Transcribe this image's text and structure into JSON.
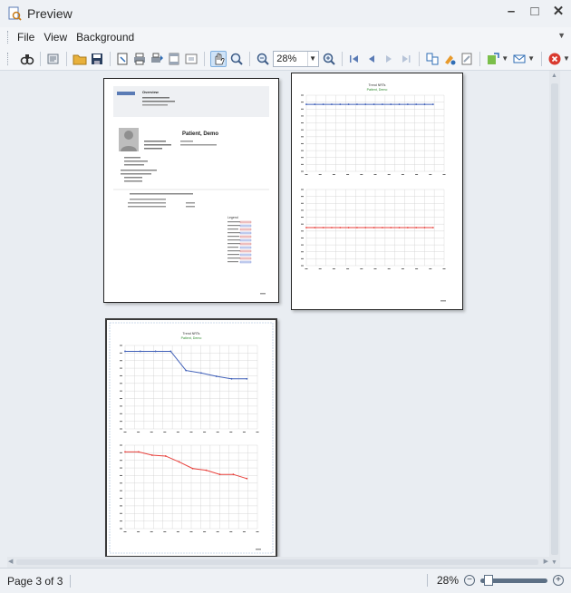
{
  "window": {
    "title": "Preview"
  },
  "menu": {
    "items": [
      "File",
      "View",
      "Background"
    ]
  },
  "toolbar": {
    "zoom_value": "28%",
    "buttons": [
      "find-icon",
      "open-icon",
      "save-icon",
      "page-setup-icon",
      "print-icon",
      "quick-print-icon",
      "header-footer-icon",
      "scale-icon",
      "hand-tool-icon",
      "magnifier-icon",
      "zoom-out-icon",
      "zoom-in-icon",
      "first-page-icon",
      "previous-page-icon",
      "next-page-icon",
      "last-page-icon",
      "multiple-pages-icon",
      "color-icon",
      "watermark-icon",
      "export-icon",
      "send-icon",
      "close-preview-icon"
    ]
  },
  "report": {
    "page1": {
      "header_title": "Overview",
      "patient_name": "Patient, Demo",
      "legend_title": "Legend"
    },
    "chart_pages": {
      "title": "Trend NRTs",
      "subtitle": "Patient, Demo"
    }
  },
  "status": {
    "page_text": "Page 3 of 3",
    "zoom_text": "28%"
  },
  "chart_data": [
    {
      "type": "line",
      "title": "Trend NRTs",
      "subtitle": "Patient, Demo",
      "x": [
        1,
        2,
        3,
        4,
        5,
        6,
        7,
        8,
        9,
        10,
        11,
        12,
        13,
        14,
        15,
        16
      ],
      "series": [
        {
          "values": [
            88,
            88,
            88,
            88,
            88,
            88,
            88,
            88,
            88,
            88,
            88,
            88,
            88,
            88,
            88,
            88
          ],
          "color": "#3f5fb8"
        }
      ],
      "ylim": [
        0,
        100
      ],
      "grid": true
    },
    {
      "type": "line",
      "x": [
        1,
        2,
        3,
        4,
        5,
        6,
        7,
        8,
        9,
        10,
        11,
        12,
        13,
        14,
        15,
        16
      ],
      "series": [
        {
          "values": [
            50,
            50,
            50,
            50,
            50,
            50,
            50,
            50,
            50,
            50,
            50,
            50,
            50,
            50,
            50,
            50
          ],
          "color": "#e8413c"
        }
      ],
      "ylim": [
        0,
        100
      ],
      "grid": true
    },
    {
      "type": "line",
      "title": "Trend NRTs",
      "subtitle": "Patient, Demo",
      "x": [
        1,
        2,
        3,
        4,
        5,
        6,
        7,
        8,
        9
      ],
      "series": [
        {
          "values": [
            93,
            93,
            93,
            93,
            70,
            67,
            63,
            60,
            60
          ],
          "color": "#3f5fb8"
        }
      ],
      "ylim": [
        0,
        100
      ],
      "grid": true
    },
    {
      "type": "line",
      "x": [
        1,
        2,
        3,
        4,
        5,
        6,
        7,
        8,
        9,
        10
      ],
      "series": [
        {
          "values": [
            92,
            92,
            88,
            87,
            80,
            72,
            70,
            65,
            65,
            60
          ],
          "color": "#e8413c"
        }
      ],
      "ylim": [
        0,
        100
      ],
      "grid": true
    }
  ]
}
